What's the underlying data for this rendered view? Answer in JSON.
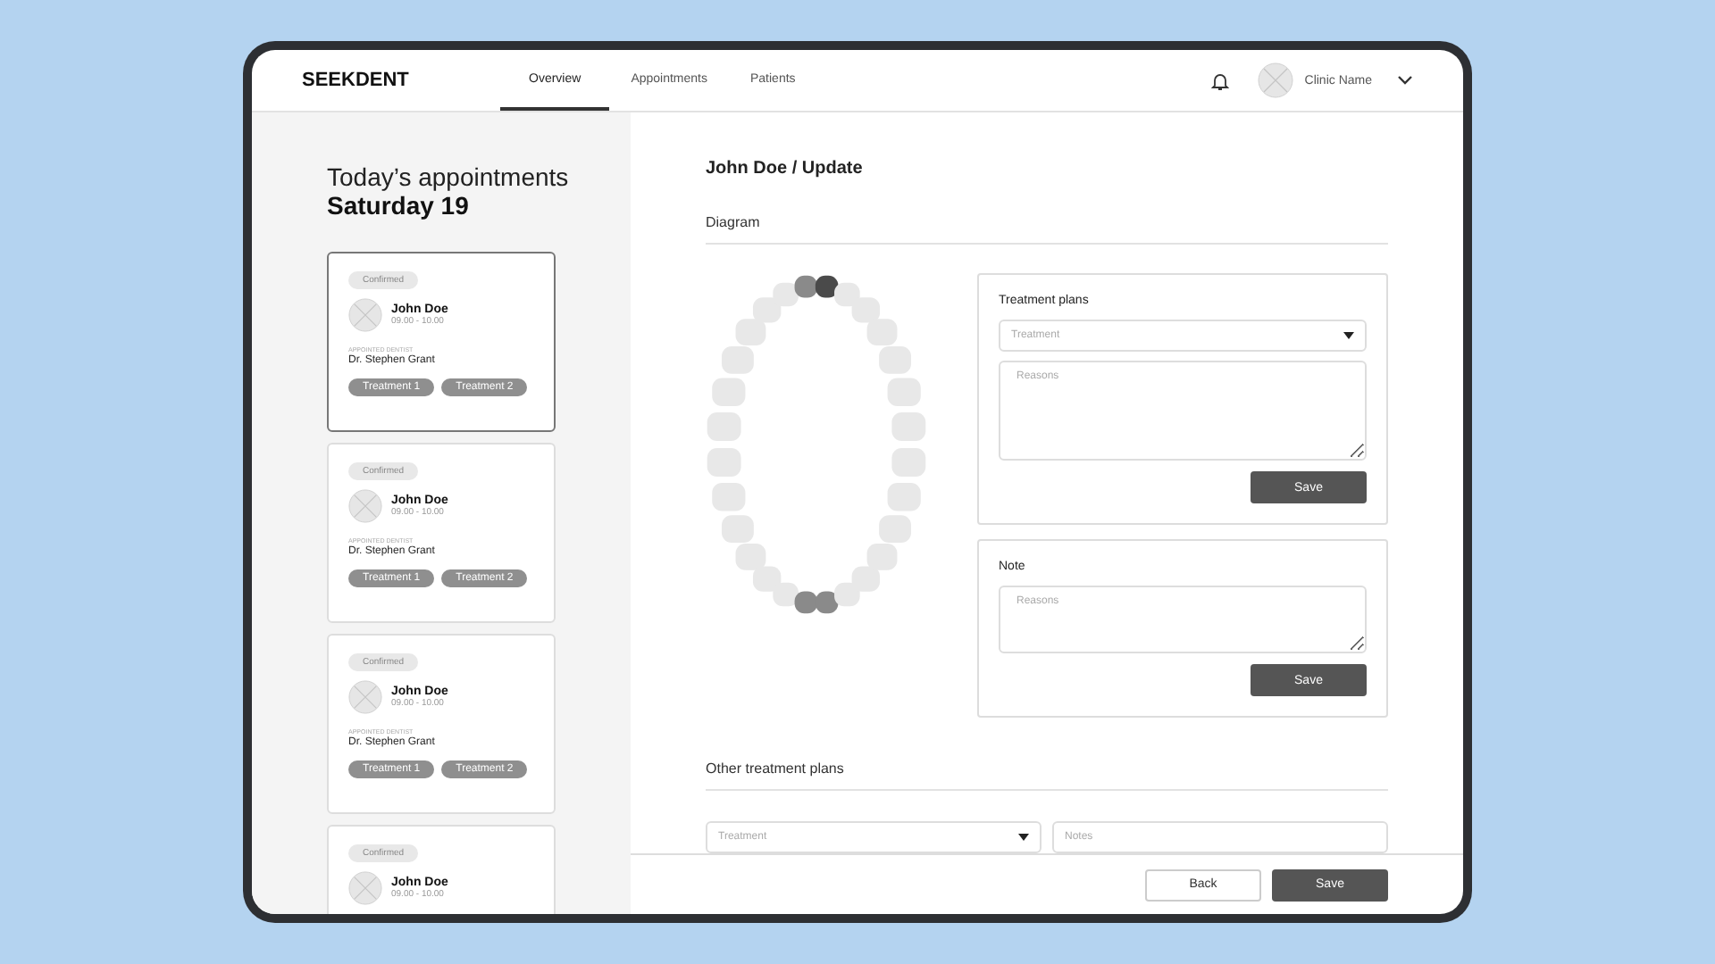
{
  "header": {
    "logo": "SEEKDENT",
    "nav": [
      {
        "label": "Overview",
        "selected": true
      },
      {
        "label": "Appointments",
        "selected": false
      },
      {
        "label": "Patients",
        "selected": false
      }
    ],
    "account": "Clinic Name"
  },
  "sidebar": {
    "title": "Today’s appointments",
    "date": "Saturday 19",
    "cards": [
      {
        "selected": true,
        "status": "Confirmed",
        "name": "John Doe",
        "time": "09.00 - 10.00",
        "dentist_label": "APPOINTED DENTIST",
        "dentist": "Dr. Stephen Grant",
        "tags": [
          "Treatment 1",
          "Treatment 2"
        ]
      },
      {
        "selected": false,
        "status": "Confirmed",
        "name": "John Doe",
        "time": "09.00 - 10.00",
        "dentist_label": "APPOINTED DENTIST",
        "dentist": "Dr. Stephen Grant",
        "tags": [
          "Treatment 1",
          "Treatment 2"
        ]
      },
      {
        "selected": false,
        "status": "Confirmed",
        "name": "John Doe",
        "time": "09.00 - 10.00",
        "dentist_label": "APPOINTED DENTIST",
        "dentist": "Dr. Stephen Grant",
        "tags": [
          "Treatment 1",
          "Treatment 2"
        ]
      },
      {
        "selected": false,
        "status": "Confirmed",
        "name": "John Doe",
        "time": "09.00 - 10.00"
      }
    ]
  },
  "main": {
    "title": "John Doe / Update",
    "diagram_heading": "Diagram",
    "teeth": [
      {
        "color": "#e8e8e8"
      },
      {
        "color": "#e8e8e8"
      },
      {
        "color": "#e8e8e8"
      },
      {
        "color": "#e8e8e8"
      },
      {
        "color": "#e8e8e8"
      },
      {
        "color": "#e8e8e8"
      },
      {
        "color": "#8a8a8a"
      },
      {
        "color": "#4a4a4a"
      },
      {
        "color": "#e8e8e8"
      },
      {
        "color": "#e8e8e8"
      },
      {
        "color": "#e8e8e8"
      },
      {
        "color": "#e8e8e8"
      },
      {
        "color": "#e8e8e8"
      },
      {
        "color": "#e8e8e8"
      },
      {
        "color": "#e8e8e8"
      },
      {
        "color": "#e8e8e8"
      },
      {
        "color": "#e8e8e8"
      },
      {
        "color": "#e8e8e8"
      },
      {
        "color": "#e8e8e8"
      },
      {
        "color": "#e8e8e8"
      },
      {
        "color": "#8a8a8a"
      },
      {
        "color": "#8a8a8a"
      },
      {
        "color": "#e8e8e8"
      },
      {
        "color": "#e8e8e8"
      },
      {
        "color": "#e8e8e8"
      },
      {
        "color": "#e8e8e8"
      },
      {
        "color": "#e8e8e8"
      },
      {
        "color": "#e8e8e8"
      }
    ],
    "panels": [
      {
        "title": "Treatment plans",
        "select_placeholder": "Treatment",
        "reasons_placeholder": "Reasons",
        "button": "Save"
      },
      {
        "title": "Note",
        "reasons_placeholder": "Reasons",
        "button": "Save"
      }
    ],
    "other_heading": "Other treatment plans",
    "other_select_placeholder": "Treatment",
    "other_notes_placeholder": "Notes"
  },
  "footer": {
    "buttons": [
      "Back",
      "Save"
    ]
  }
}
